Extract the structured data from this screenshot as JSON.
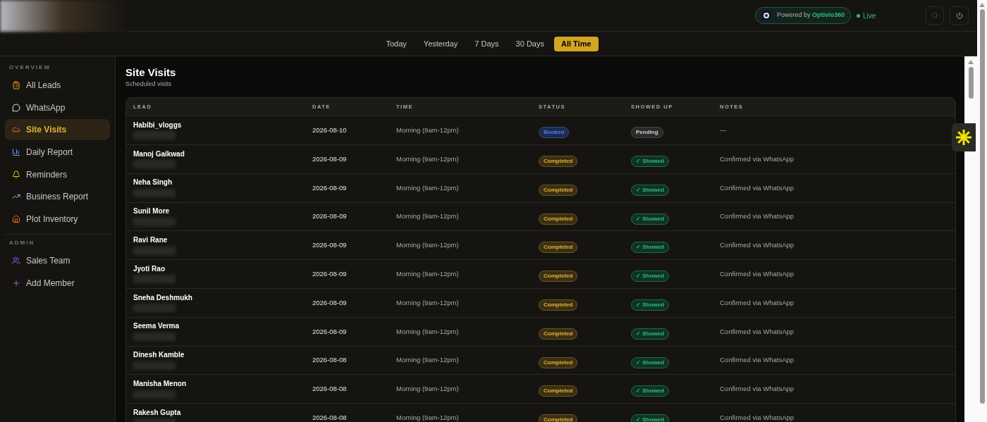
{
  "header": {
    "powered_prefix": "Powered by",
    "powered_brand": "Optivio360",
    "live": "Live"
  },
  "filters": [
    {
      "label": "Today",
      "selected": false
    },
    {
      "label": "Yesterday",
      "selected": false
    },
    {
      "label": "7 Days",
      "selected": false
    },
    {
      "label": "30 Days",
      "selected": false
    },
    {
      "label": "All Time",
      "selected": true
    }
  ],
  "sidebar": {
    "sections": [
      {
        "title": "OVERVIEW",
        "items": [
          {
            "label": "All Leads",
            "kind": "clipboard",
            "selected": false
          },
          {
            "label": "WhatsApp",
            "kind": "chat",
            "selected": false
          },
          {
            "label": "Site Visits",
            "kind": "car",
            "selected": true
          },
          {
            "label": "Daily Report",
            "kind": "bars",
            "selected": false
          },
          {
            "label": "Reminders",
            "kind": "bell",
            "selected": false
          },
          {
            "label": "Business Report",
            "kind": "trend",
            "selected": false
          },
          {
            "label": "Plot Inventory",
            "kind": "house",
            "selected": false
          }
        ]
      },
      {
        "title": "ADMIN",
        "items": [
          {
            "label": "Sales Team",
            "kind": "users",
            "selected": false
          },
          {
            "label": "Add Member",
            "kind": "plus",
            "selected": false
          }
        ]
      }
    ]
  },
  "page": {
    "title": "Site Visits",
    "subtitle": "Scheduled visits"
  },
  "table": {
    "columns": [
      "LEAD",
      "DATE",
      "TIME",
      "STATUS",
      "SHOWED UP",
      "NOTES"
    ],
    "rows": [
      {
        "lead": "Habibi_vloggs",
        "date": "2026-08-10",
        "time": "Morning (9am-12pm)",
        "status": {
          "label": "Booked",
          "kind": "booked"
        },
        "showed": {
          "label": "Pending",
          "kind": "pending"
        },
        "notes": "—"
      },
      {
        "lead": "Manoj Gaikwad",
        "date": "2026-08-09",
        "time": "Morning (9am-12pm)",
        "status": {
          "label": "Completed",
          "kind": "completed"
        },
        "showed": {
          "label": "✓ Showed",
          "kind": "showed"
        },
        "notes": "Confirmed via WhatsApp"
      },
      {
        "lead": "Neha Singh",
        "date": "2026-08-09",
        "time": "Morning (9am-12pm)",
        "status": {
          "label": "Completed",
          "kind": "completed"
        },
        "showed": {
          "label": "✓ Showed",
          "kind": "showed"
        },
        "notes": "Confirmed via WhatsApp"
      },
      {
        "lead": "Sunil More",
        "date": "2026-08-09",
        "time": "Morning (9am-12pm)",
        "status": {
          "label": "Completed",
          "kind": "completed"
        },
        "showed": {
          "label": "✓ Showed",
          "kind": "showed"
        },
        "notes": "Confirmed via WhatsApp"
      },
      {
        "lead": "Ravi Rane",
        "date": "2026-08-09",
        "time": "Morning (9am-12pm)",
        "status": {
          "label": "Completed",
          "kind": "completed"
        },
        "showed": {
          "label": "✓ Showed",
          "kind": "showed"
        },
        "notes": "Confirmed via WhatsApp"
      },
      {
        "lead": "Jyoti Rao",
        "date": "2026-08-09",
        "time": "Morning (9am-12pm)",
        "status": {
          "label": "Completed",
          "kind": "completed"
        },
        "showed": {
          "label": "✓ Showed",
          "kind": "showed"
        },
        "notes": "Confirmed via WhatsApp"
      },
      {
        "lead": "Sneha Deshmukh",
        "date": "2026-08-09",
        "time": "Morning (9am-12pm)",
        "status": {
          "label": "Completed",
          "kind": "completed"
        },
        "showed": {
          "label": "✓ Showed",
          "kind": "showed"
        },
        "notes": "Confirmed via WhatsApp"
      },
      {
        "lead": "Seema Verma",
        "date": "2026-08-09",
        "time": "Morning (9am-12pm)",
        "status": {
          "label": "Completed",
          "kind": "completed"
        },
        "showed": {
          "label": "✓ Showed",
          "kind": "showed"
        },
        "notes": "Confirmed via WhatsApp"
      },
      {
        "lead": "Dinesh Kamble",
        "date": "2026-08-08",
        "time": "Morning (9am-12pm)",
        "status": {
          "label": "Completed",
          "kind": "completed"
        },
        "showed": {
          "label": "✓ Showed",
          "kind": "showed"
        },
        "notes": "Confirmed via WhatsApp"
      },
      {
        "lead": "Manisha Menon",
        "date": "2026-08-08",
        "time": "Morning (9am-12pm)",
        "status": {
          "label": "Completed",
          "kind": "completed"
        },
        "showed": {
          "label": "✓ Showed",
          "kind": "showed"
        },
        "notes": "Confirmed via WhatsApp"
      },
      {
        "lead": "Rakesh Gupta",
        "date": "2026-08-08",
        "time": "Morning (9am-12pm)",
        "status": {
          "label": "Completed",
          "kind": "completed"
        },
        "showed": {
          "label": "✓ Showed",
          "kind": "showed"
        },
        "notes": "Confirmed via WhatsApp"
      }
    ]
  }
}
